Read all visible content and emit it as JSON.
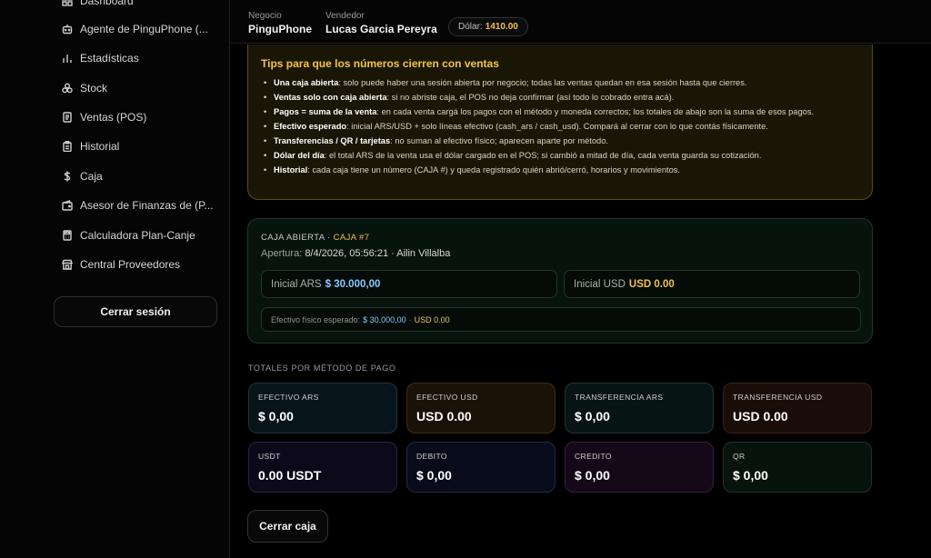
{
  "sidebar": {
    "items": [
      {
        "label": "Dashboard",
        "icon": "dashboard-icon"
      },
      {
        "label": "Agente de PinguPhone (...",
        "icon": "bot-icon"
      },
      {
        "label": "Estadísticas",
        "icon": "chart-icon"
      },
      {
        "label": "Stock",
        "icon": "boxes-icon"
      },
      {
        "label": "Ventas (POS)",
        "icon": "receipt-icon"
      },
      {
        "label": "Historial",
        "icon": "clipboard-icon"
      },
      {
        "label": "Caja",
        "icon": "dollar-icon"
      },
      {
        "label": "Asesor de Finanzas de (P...",
        "icon": "wallet-icon"
      },
      {
        "label": "Calculadora Plan-Canje",
        "icon": "calculator-icon"
      },
      {
        "label": "Central Proveedores",
        "icon": "store-icon"
      }
    ],
    "logout_label": "Cerrar sesión"
  },
  "header": {
    "negocio_label": "Negocio",
    "negocio_value": "PinguPhone",
    "vendedor_label": "Vendedor",
    "vendedor_value": "Lucas Garcia Pereyra",
    "dolar_label": "Dólar:",
    "dolar_value": "1410.00"
  },
  "tips": {
    "title": "Tips para que los números cierren con ventas",
    "items": [
      {
        "bold": "Una caja abierta",
        "text": ": solo puede haber una sesión abierta por negocio; todas las ventas quedan en esa sesión hasta que cierres."
      },
      {
        "bold": "Ventas solo con caja abierta",
        "text": ": si no abriste caja, el POS no deja confirmar (así todo lo cobrado entra acá)."
      },
      {
        "bold": "Pagos = suma de la venta",
        "text": ": en cada venta cargá los pagos con el método y moneda correctos; los totales de abajo son la suma de esos pagos."
      },
      {
        "bold": "Efectivo esperado",
        "text": ": inicial ARS/USD + solo líneas efectivo (cash_ars / cash_usd). Compará al cerrar con lo que contás físicamente."
      },
      {
        "bold": "Transferencias / QR / tarjetas",
        "text": ": no suman al efectivo físico; aparecen aparte por método."
      },
      {
        "bold": "Dólar del día",
        "text": ": el total ARS de la venta usa el dólar cargado en el POS; si cambió a mitad de día, cada venta guarda su cotización."
      },
      {
        "bold": "Historial",
        "text": ": cada caja tiene un número (CAJA #) y queda registrado quién abrió/cerró, horarios y movimientos."
      }
    ]
  },
  "caja": {
    "status": "CAJA ABIERTA",
    "separator": "·",
    "number": "CAJA #7",
    "apertura_label": "Apertura:",
    "apertura_value": "8/4/2026, 05:56:21 · Ailin Villalba",
    "inicial_ars_label": "Inicial ARS",
    "inicial_ars_value": "$ 30.000,00",
    "inicial_usd_label": "Inicial USD",
    "inicial_usd_value": "USD 0.00",
    "esperado_label": "Efectivo físico esperado:",
    "esperado_ars": "$ 30.000,00",
    "esperado_sep": "·",
    "esperado_usd": "USD 0.00"
  },
  "totals": {
    "title": "TOTALES POR MÉTODO DE PAGO",
    "cards": [
      {
        "label": "EFECTIVO ARS",
        "value": "$ 0,00",
        "bg": "#07141a",
        "border": "#1f3540"
      },
      {
        "label": "EFECTIVO USD",
        "value": "USD 0.00",
        "bg": "#1a1206",
        "border": "#3d2e12"
      },
      {
        "label": "TRANSFERENCIA ARS",
        "value": "$ 0,00",
        "bg": "#061413",
        "border": "#1c3634"
      },
      {
        "label": "TRANSFERENCIA USD",
        "value": "USD 0.00",
        "bg": "#1a0d07",
        "border": "#3d2116"
      },
      {
        "label": "USDT",
        "value": "0.00 USDT",
        "bg": "#0c0a1a",
        "border": "#282344"
      },
      {
        "label": "DEBITO",
        "value": "$ 0,00",
        "bg": "#080c1a",
        "border": "#212a44"
      },
      {
        "label": "CREDITO",
        "value": "$ 0,00",
        "bg": "#150818",
        "border": "#3a1e3e"
      },
      {
        "label": "QR",
        "value": "$ 0,00",
        "bg": "#07130d",
        "border": "#1c3528"
      }
    ]
  },
  "close_label": "Cerrar caja"
}
